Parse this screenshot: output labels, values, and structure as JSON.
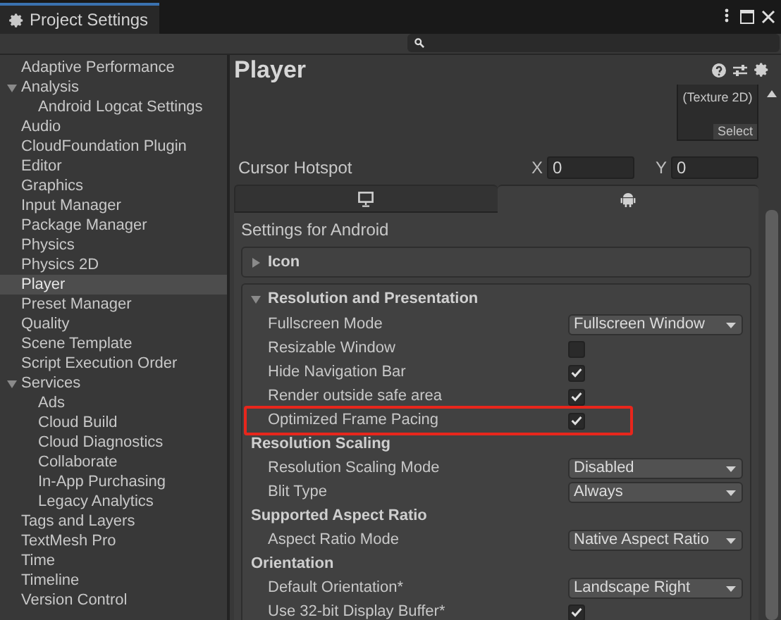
{
  "window": {
    "title": "Project Settings"
  },
  "sidebar": {
    "items": [
      {
        "label": "Adaptive Performance",
        "selected": false
      },
      {
        "label": "Analysis",
        "selected": false,
        "expanded": true,
        "children": [
          {
            "label": "Android Logcat Settings",
            "selected": false
          }
        ]
      },
      {
        "label": "Audio",
        "selected": false
      },
      {
        "label": "CloudFoundation Plugin",
        "selected": false
      },
      {
        "label": "Editor",
        "selected": false
      },
      {
        "label": "Graphics",
        "selected": false
      },
      {
        "label": "Input Manager",
        "selected": false
      },
      {
        "label": "Package Manager",
        "selected": false
      },
      {
        "label": "Physics",
        "selected": false
      },
      {
        "label": "Physics 2D",
        "selected": false
      },
      {
        "label": "Player",
        "selected": true
      },
      {
        "label": "Preset Manager",
        "selected": false
      },
      {
        "label": "Quality",
        "selected": false
      },
      {
        "label": "Scene Template",
        "selected": false
      },
      {
        "label": "Script Execution Order",
        "selected": false
      },
      {
        "label": "Services",
        "selected": false,
        "expanded": true,
        "children": [
          {
            "label": "Ads",
            "selected": false
          },
          {
            "label": "Cloud Build",
            "selected": false
          },
          {
            "label": "Cloud Diagnostics",
            "selected": false
          },
          {
            "label": "Collaborate",
            "selected": false
          },
          {
            "label": "In-App Purchasing",
            "selected": false
          },
          {
            "label": "Legacy Analytics",
            "selected": false
          }
        ]
      },
      {
        "label": "Tags and Layers",
        "selected": false
      },
      {
        "label": "TextMesh Pro",
        "selected": false
      },
      {
        "label": "Time",
        "selected": false
      },
      {
        "label": "Timeline",
        "selected": false
      },
      {
        "label": "Version Control",
        "selected": false
      }
    ]
  },
  "inspector": {
    "title": "Player",
    "default_cursor": {
      "texture_type": "(Texture 2D)",
      "select_button": "Select"
    },
    "cursor_hotspot": {
      "label": "Cursor Hotspot",
      "x_label": "X",
      "x_value": "0",
      "y_label": "Y",
      "y_value": "0"
    },
    "platform_tabs": [
      {
        "kind": "monitor",
        "selected": false
      },
      {
        "kind": "android",
        "selected": true
      }
    ],
    "settings_title": "Settings for Android",
    "sections": [
      {
        "title": "Icon",
        "expanded": false
      },
      {
        "title": "Resolution and Presentation",
        "expanded": true,
        "rows": [
          {
            "kind": "dropdown",
            "label": "Fullscreen Mode",
            "value": "Fullscreen Window"
          },
          {
            "kind": "checkbox",
            "label": "Resizable Window",
            "checked": false
          },
          {
            "kind": "checkbox",
            "label": "Hide Navigation Bar",
            "checked": true
          },
          {
            "kind": "checkbox",
            "label": "Render outside safe area",
            "checked": true
          },
          {
            "kind": "checkbox",
            "label": "Optimized Frame Pacing",
            "checked": true,
            "highlighted": true
          },
          {
            "kind": "header",
            "label": "Resolution Scaling"
          },
          {
            "kind": "dropdown",
            "label": "Resolution Scaling Mode",
            "value": "Disabled"
          },
          {
            "kind": "dropdown",
            "label": "Blit Type",
            "value": "Always"
          },
          {
            "kind": "header",
            "label": "Supported Aspect Ratio"
          },
          {
            "kind": "dropdown",
            "label": "Aspect Ratio Mode",
            "value": "Native Aspect Ratio"
          },
          {
            "kind": "header",
            "label": "Orientation"
          },
          {
            "kind": "dropdown",
            "label": "Default Orientation*",
            "value": "Landscape Right"
          },
          {
            "kind": "checkbox",
            "label": "Use 32-bit Display Buffer*",
            "checked": true
          }
        ]
      }
    ]
  }
}
